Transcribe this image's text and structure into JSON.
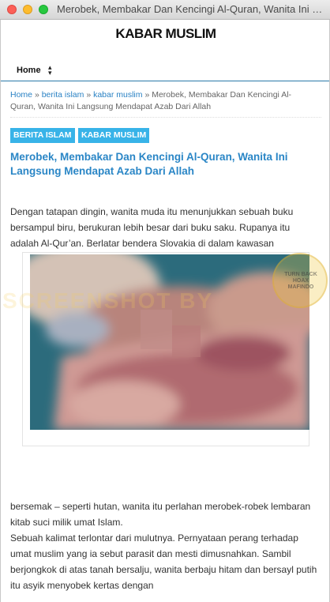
{
  "window": {
    "title": "Merobek, Membakar Dan Kencingi Al-Quran, Wanita Ini Langsung Mendapat Azab Dari Allah"
  },
  "site": {
    "title": "KABAR MUSLIM"
  },
  "nav": {
    "home_label": "Home",
    "home_arrows": "▴▾"
  },
  "breadcrumb": {
    "home": "Home",
    "sep": "»",
    "cat1": "berita islam",
    "cat2": "kabar muslim",
    "current": "Merobek, Membakar Dan Kencingi Al-Quran, Wanita Ini Langsung Mendapat Azab Dari Allah"
  },
  "tags": [
    "BERITA ISLAM",
    "KABAR MUSLIM"
  ],
  "article": {
    "headline": "Merobek, Membakar Dan Kencingi Al-Quran, Wanita Ini Langsung Mendapat Azab Dari Allah",
    "paragraph1": "Dengan tatapan dingin, wanita muda itu menunjukkan sebuah buku bersampul biru, berukuran lebih besar dari buku saku. Rupanya itu adalah Al-Qur’an. Berlatar bendera Slovakia di dalam kawasan",
    "paragraph2": "bersemak – seperti hutan, wanita itu perlahan merobek-robek lembaran kitab suci milik umat Islam.",
    "paragraph3": "Sebuah kalimat terlontar dari mulutnya. Pernyataan perang terhadap umat muslim yang ia sebut parasit dan mesti dimusnahkan. Sambil berjongkok di atas tanah bersalju, wanita berbaju hitam dan bersayl putih itu asyik menyobek kertas dengan"
  },
  "overlay": {
    "watermark": "SCREENSHOT BY",
    "badge": "TURN BACK HOAX MAFINDO"
  },
  "colors": {
    "accent_blue": "#2a86c6",
    "tag_bg": "#38b3e8",
    "nav_border": "#2a7aa8"
  }
}
